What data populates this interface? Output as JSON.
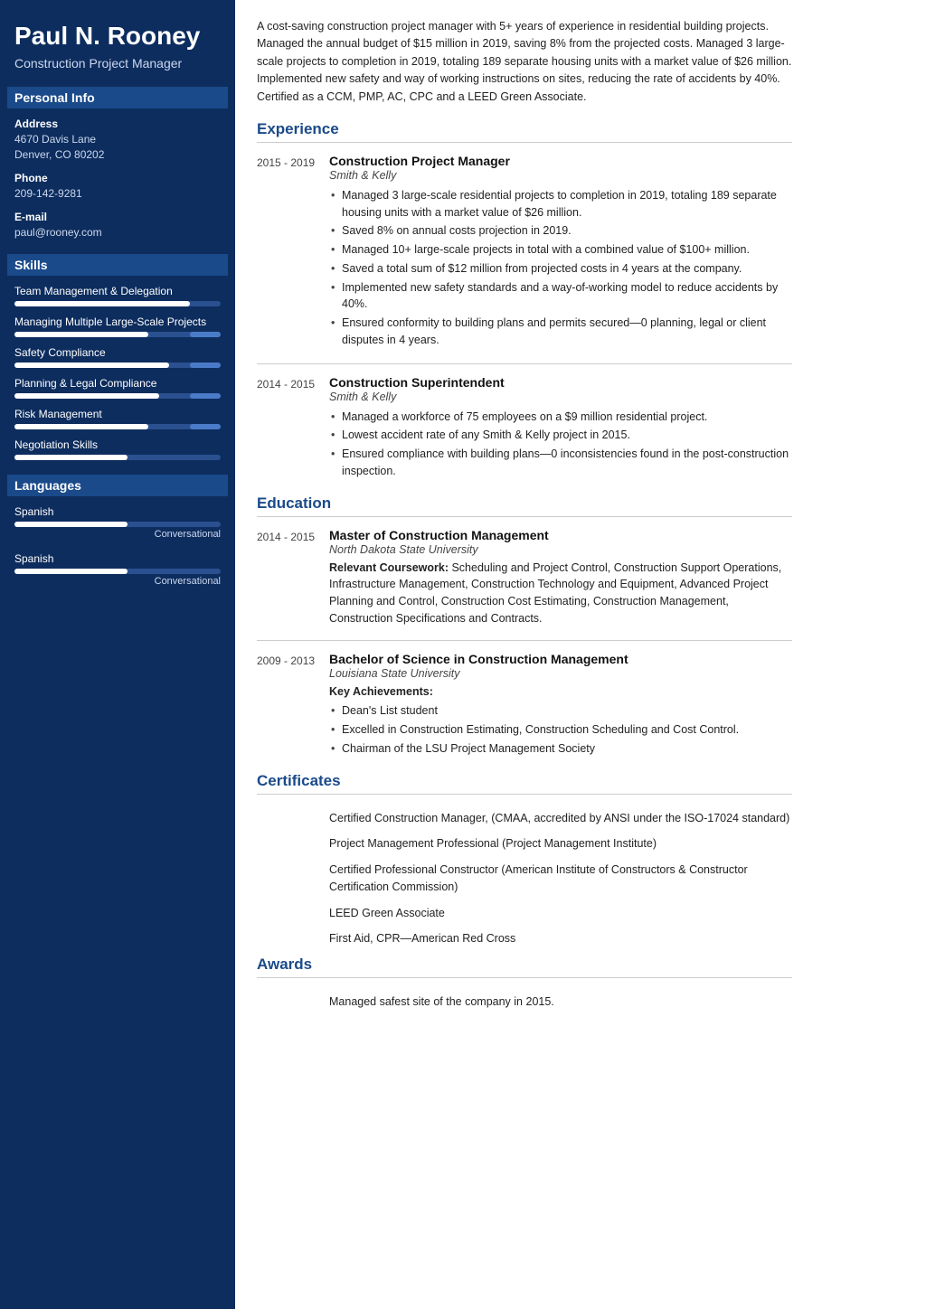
{
  "sidebar": {
    "name": "Paul N. Rooney",
    "title": "Construction Project Manager",
    "personal_info_label": "Personal Info",
    "address_label": "Address",
    "address_value": "4670 Davis Lane\nDenver, CO 80202",
    "phone_label": "Phone",
    "phone_value": "209-142-9281",
    "email_label": "E-mail",
    "email_value": "paul@rooney.com",
    "skills_label": "Skills",
    "skills": [
      {
        "name": "Team Management & Delegation",
        "fill": 85,
        "extra": 0
      },
      {
        "name": "Managing Multiple Large-Scale Projects",
        "fill": 65,
        "extra": 15
      },
      {
        "name": "Safety Compliance",
        "fill": 75,
        "extra": 15
      },
      {
        "name": "Planning & Legal Compliance",
        "fill": 70,
        "extra": 15
      },
      {
        "name": "Risk Management",
        "fill": 65,
        "extra": 15
      },
      {
        "name": "Negotiation Skills",
        "fill": 55,
        "extra": 0
      }
    ],
    "languages_label": "Languages",
    "languages": [
      {
        "name": "Spanish",
        "fill": 55,
        "level": "Conversational"
      },
      {
        "name": "Spanish",
        "fill": 55,
        "level": "Conversational"
      }
    ]
  },
  "main": {
    "summary": "A cost-saving construction project manager with 5+ years of experience in residential building projects. Managed the annual budget of $15 million in 2019, saving 8% from the projected costs. Managed 3 large-scale projects to completion in 2019, totaling 189 separate housing units with a market value of $26 million. Implemented new safety and way of working instructions on sites, reducing the rate of accidents by 40%. Certified as a CCM, PMP, AC, CPC and a LEED Green Associate.",
    "experience_heading": "Experience",
    "experience": [
      {
        "dates": "2015 - 2019",
        "title": "Construction Project Manager",
        "company": "Smith & Kelly",
        "bullets": [
          "Managed 3 large-scale residential projects to completion in 2019, totaling 189 separate housing units with a market value of $26 million.",
          "Saved 8% on annual costs projection in 2019.",
          "Managed 10+ large-scale projects in total with a combined value of $100+ million.",
          "Saved a total sum of $12 million from projected costs in 4 years at the company.",
          "Implemented new safety standards and a way-of-working model to reduce accidents by 40%.",
          "Ensured conformity to building plans and permits secured—0 planning, legal or client disputes in 4 years."
        ]
      },
      {
        "dates": "2014 - 2015",
        "title": "Construction Superintendent",
        "company": "Smith & Kelly",
        "bullets": [
          "Managed a workforce of 75 employees on a $9 million residential project.",
          "Lowest accident rate of any Smith & Kelly project in 2015.",
          "Ensured compliance with building plans—0 inconsistencies found in the post-construction inspection."
        ]
      }
    ],
    "education_heading": "Education",
    "education": [
      {
        "dates": "2014 - 2015",
        "degree": "Master of Construction Management",
        "school": "North Dakota State University",
        "details_bold": "Relevant Coursework:",
        "details": " Scheduling and Project Control, Construction Support Operations, Infrastructure Management, Construction Technology and Equipment, Advanced Project Planning and Control, Construction Cost Estimating, Construction Management, Construction Specifications and Contracts.",
        "bullets": []
      },
      {
        "dates": "2009 - 2013",
        "degree": "Bachelor of Science in Construction Management",
        "school": "Louisiana State University",
        "details_bold": "Key Achievements:",
        "details": "",
        "bullets": [
          "Dean's List student",
          "Excelled in Construction Estimating, Construction Scheduling and Cost Control.",
          "Chairman of the LSU Project Management Society"
        ]
      }
    ],
    "certificates_heading": "Certificates",
    "certificates": [
      "Certified Construction Manager, (CMAA, accredited by ANSI under the ISO-17024 standard)",
      "Project Management Professional (Project Management Institute)",
      "Certified Professional Constructor (American Institute of Constructors & Constructor Certification Commission)",
      "LEED Green Associate",
      "First Aid, CPR—American Red Cross"
    ],
    "awards_heading": "Awards",
    "awards": [
      "Managed safest site of the company in 2015."
    ]
  }
}
